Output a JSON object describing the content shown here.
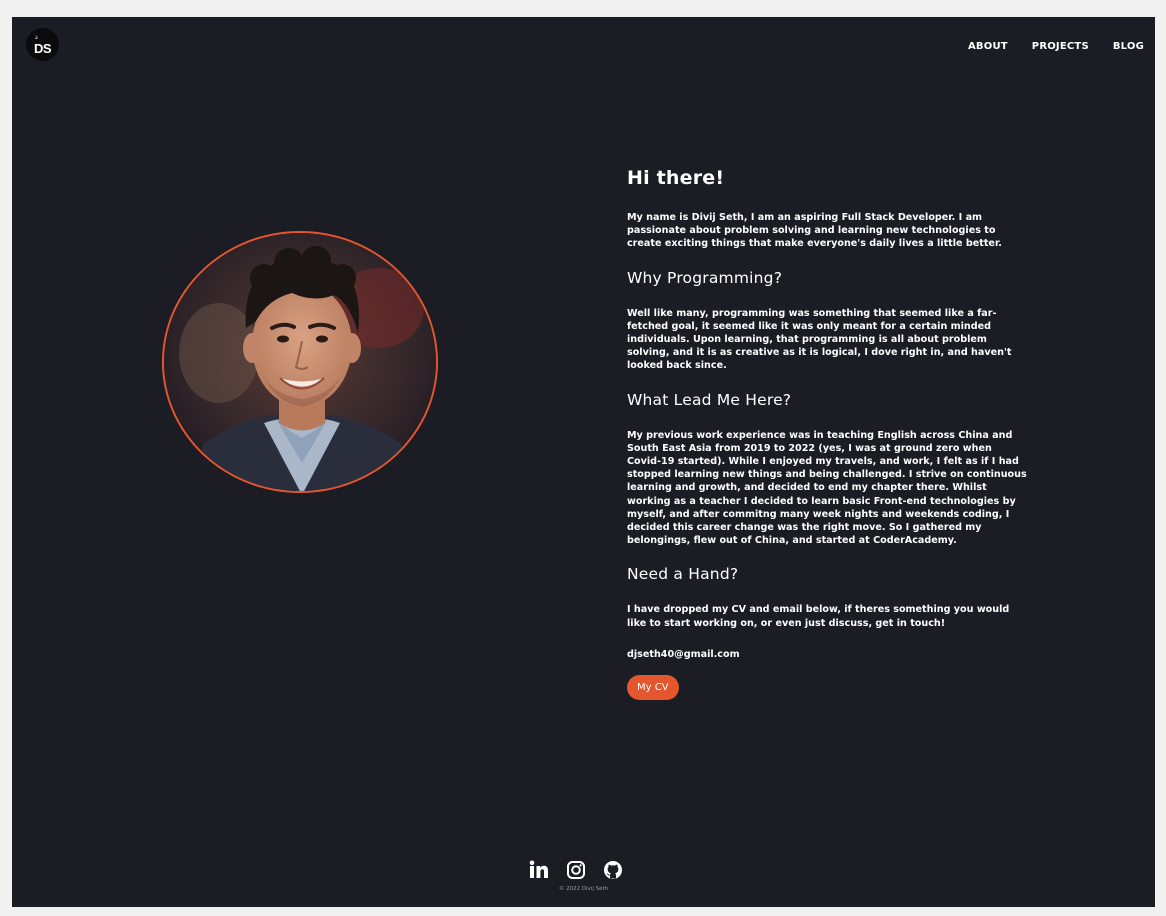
{
  "header": {
    "logo_text": "DS",
    "nav": [
      "ABOUT",
      "PROJECTS",
      "BLOG"
    ]
  },
  "about": {
    "greeting": "Hi there!",
    "intro": "My name is Divij Seth, I am an aspiring Full Stack Developer. I am passionate about problem solving and learning new technologies to create exciting things that make everyone's daily lives a little better.",
    "why_heading": "Why Programming?",
    "why_text": "Well like many, programming was something that seemed like a far-fetched goal, it seemed like it was only meant for a certain minded individuals. Upon learning, that programming is all about problem solving, and it is as creative as it is logical, I dove right in, and haven't looked back since.",
    "lead_heading": "What Lead Me Here?",
    "lead_text": "My previous work experience was in teaching English across China and South East Asia from 2019 to 2022 (yes, I was at ground zero when Covid-19 started). While I enjoyed my travels, and work, I felt as if I had stopped learning new things and being challenged. I strive on continuous learning and growth, and decided to end my chapter there. Whilst working as a teacher I decided to learn basic Front-end technologies by myself, and after commitng many week nights and weekends coding, I decided this career change was the right move. So I gathered my belongings, flew out of China, and started at CoderAcademy.",
    "hand_heading": "Need a Hand?",
    "hand_text": "I have dropped my CV and email below, if theres something you would like to start working on, or even just discuss, get in touch!",
    "email": "djseth40@gmail.com",
    "cv_button": "My CV"
  },
  "footer": {
    "social_icons": [
      "linkedin-icon",
      "instagram-icon",
      "github-icon"
    ],
    "copyright": "© 2022 Divij Seth"
  },
  "colors": {
    "background": "#1c1c24",
    "accent": "#e4572e",
    "text": "#ffffff"
  }
}
